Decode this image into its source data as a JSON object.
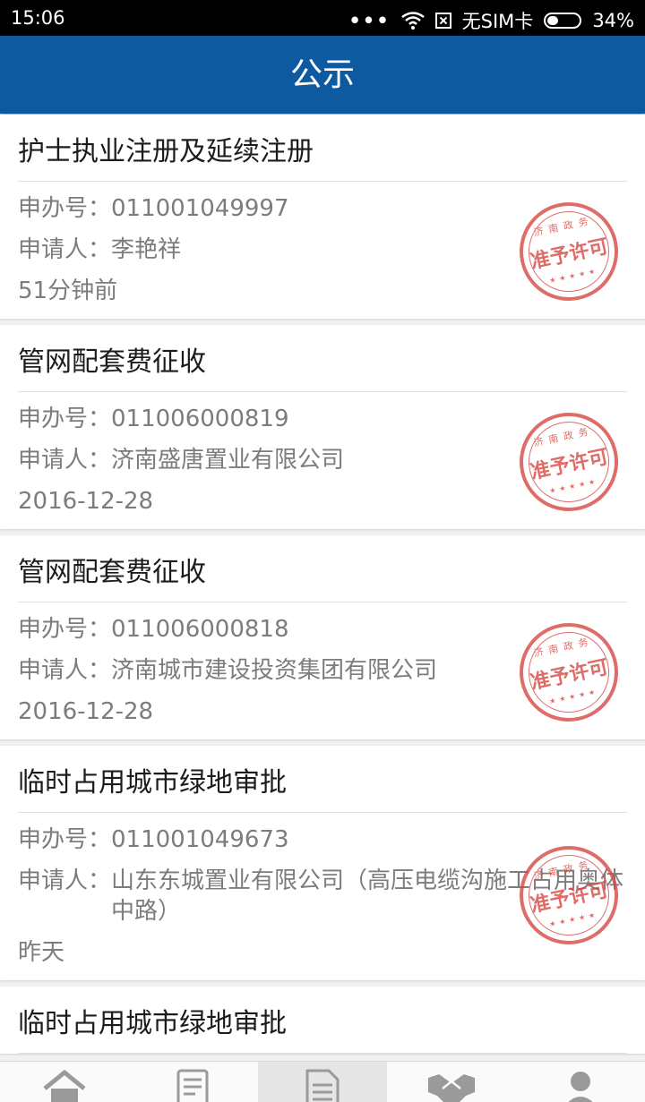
{
  "status_bar": {
    "time": "15:06",
    "dots": "•••",
    "sim_text": "无SIM卡",
    "battery": "34%"
  },
  "header": {
    "title": "公示"
  },
  "labels": {
    "application_no": "申办号：",
    "applicant": "申请人："
  },
  "stamp": {
    "top_text": "济南政务",
    "main_text": "准予许可",
    "stars": "★★★★★"
  },
  "items": [
    {
      "title": "护士执业注册及延续注册",
      "application_no": "011001049997",
      "applicant": "李艳祥",
      "time": "51分钟前"
    },
    {
      "title": "管网配套费征收",
      "application_no": "011006000819",
      "applicant": "济南盛唐置业有限公司",
      "time": "2016-12-28"
    },
    {
      "title": "管网配套费征收",
      "application_no": "011006000818",
      "applicant": "济南城市建设投资集团有限公司",
      "time": "2016-12-28"
    },
    {
      "title": "临时占用城市绿地审批",
      "application_no": "011001049673",
      "applicant": "山东东城置业有限公司（高压电缆沟施工占用奥体中路）",
      "time": "昨天"
    },
    {
      "title": "临时占用城市绿地审批"
    }
  ],
  "tabs": [
    {
      "icon": "home-icon"
    },
    {
      "icon": "form-icon"
    },
    {
      "icon": "document-icon",
      "active": true
    },
    {
      "icon": "handshake-icon"
    },
    {
      "icon": "user-icon"
    }
  ],
  "colors": {
    "header": "#0d5aa0",
    "stamp": "#d6453f"
  }
}
